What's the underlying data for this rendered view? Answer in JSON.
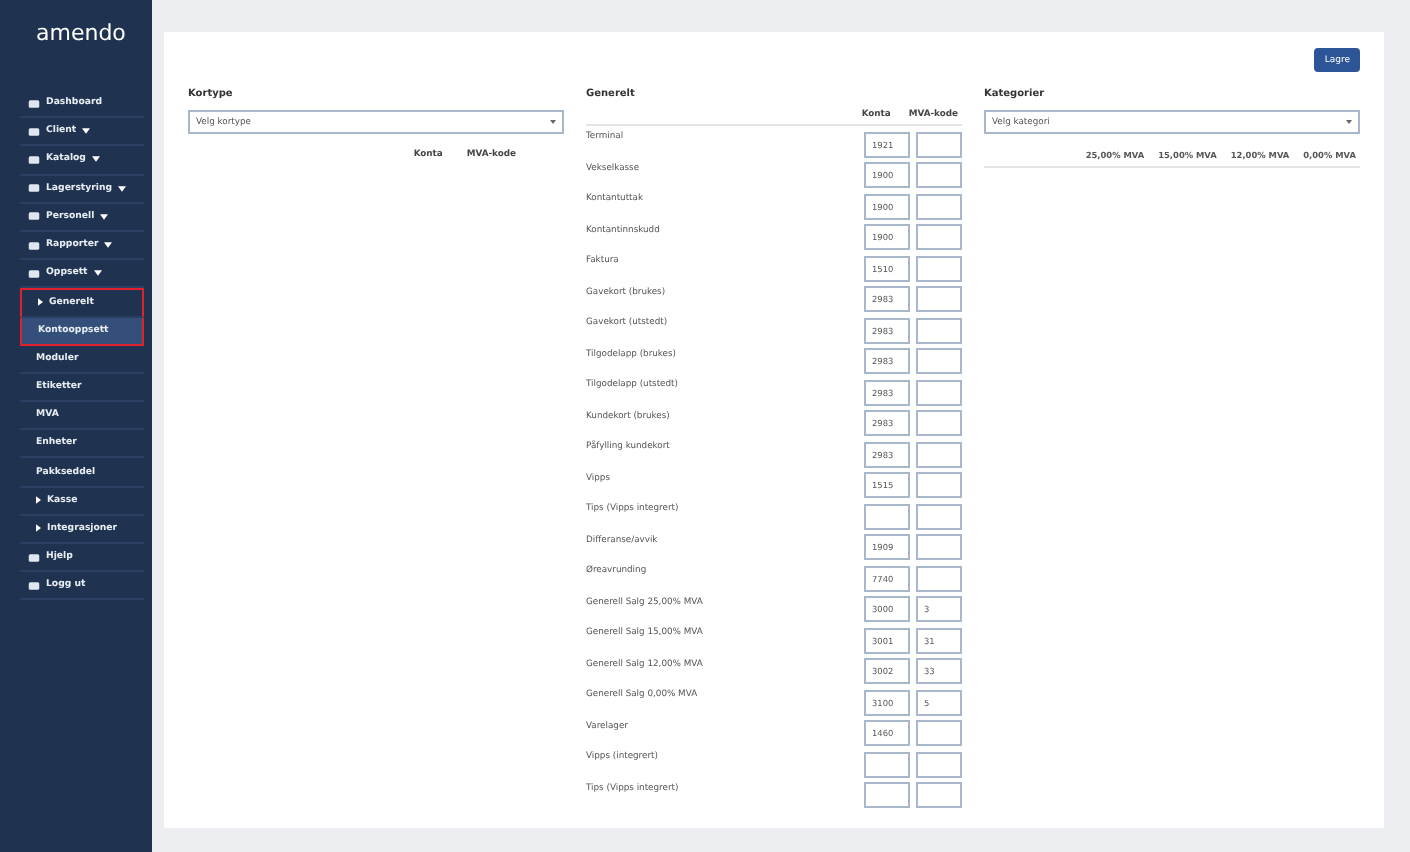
{
  "sidebar": {
    "logo": "amendo",
    "items": [
      {
        "label": "Dashboard",
        "kind": "main",
        "caret": false,
        "dropdown": false,
        "selected": false,
        "highlighted": false
      },
      {
        "label": "Client",
        "kind": "main",
        "caret": false,
        "dropdown": true,
        "selected": false,
        "highlighted": false
      },
      {
        "label": "Katalog",
        "kind": "main",
        "caret": false,
        "dropdown": true,
        "selected": false,
        "highlighted": false
      },
      {
        "label": "Lagerstyring",
        "kind": "main",
        "caret": false,
        "dropdown": true,
        "selected": false,
        "highlighted": false
      },
      {
        "label": "Personell",
        "kind": "main",
        "caret": false,
        "dropdown": true,
        "selected": false,
        "highlighted": false
      },
      {
        "label": "Rapporter",
        "kind": "main",
        "caret": false,
        "dropdown": true,
        "selected": false,
        "highlighted": false
      },
      {
        "label": "Oppsett",
        "kind": "main",
        "caret": false,
        "dropdown": true,
        "selected": false,
        "highlighted": false
      },
      {
        "label": "Generelt",
        "kind": "sub",
        "caret": true,
        "dropdown": false,
        "selected": false,
        "highlighted": true
      },
      {
        "label": "Kontooppsett",
        "kind": "sub",
        "caret": false,
        "dropdown": false,
        "selected": true,
        "highlighted": true
      },
      {
        "label": "Moduler",
        "kind": "sub",
        "caret": false,
        "dropdown": false,
        "selected": false,
        "highlighted": false
      },
      {
        "label": "Etiketter",
        "kind": "sub",
        "caret": false,
        "dropdown": false,
        "selected": false,
        "highlighted": false
      },
      {
        "label": "MVA",
        "kind": "sub",
        "caret": false,
        "dropdown": false,
        "selected": false,
        "highlighted": false
      },
      {
        "label": "Enheter",
        "kind": "sub",
        "caret": false,
        "dropdown": false,
        "selected": false,
        "highlighted": false
      },
      {
        "label": "Pakkseddel",
        "kind": "sub",
        "caret": false,
        "dropdown": false,
        "selected": false,
        "highlighted": false
      },
      {
        "label": "Kasse",
        "kind": "sub",
        "caret": true,
        "dropdown": false,
        "selected": false,
        "highlighted": false
      },
      {
        "label": "Integrasjoner",
        "kind": "sub",
        "caret": true,
        "dropdown": false,
        "selected": false,
        "highlighted": false
      },
      {
        "label": "Hjelp",
        "kind": "main",
        "caret": false,
        "dropdown": false,
        "selected": false,
        "highlighted": false
      },
      {
        "label": "Logg ut",
        "kind": "main",
        "caret": false,
        "dropdown": false,
        "selected": false,
        "highlighted": false
      }
    ]
  },
  "save_button": "Lagre",
  "kortype": {
    "title": "Kortype",
    "select": "Velg kortype",
    "columns": [
      "Konta",
      "MVA-kode"
    ]
  },
  "generelt": {
    "title": "Generelt",
    "columns": [
      "Konta",
      "MVA-kode"
    ],
    "rows": [
      {
        "label": "Terminal",
        "konta": "1921",
        "mva": ""
      },
      {
        "label": "Vekselkasse",
        "konta": "1900",
        "mva": ""
      },
      {
        "label": "Kontantuttak",
        "konta": "1900",
        "mva": ""
      },
      {
        "label": "Kontantinnskudd",
        "konta": "1900",
        "mva": ""
      },
      {
        "label": "Faktura",
        "konta": "1510",
        "mva": ""
      },
      {
        "label": "Gavekort (brukes)",
        "konta": "2983",
        "mva": ""
      },
      {
        "label": "Gavekort (utstedt)",
        "konta": "2983",
        "mva": ""
      },
      {
        "label": "Tilgodelapp (brukes)",
        "konta": "2983",
        "mva": ""
      },
      {
        "label": "Tilgodelapp (utstedt)",
        "konta": "2983",
        "mva": ""
      },
      {
        "label": "Kundekort (brukes)",
        "konta": "2983",
        "mva": ""
      },
      {
        "label": "Påfylling kundekort",
        "konta": "2983",
        "mva": ""
      },
      {
        "label": "Vipps",
        "konta": "1515",
        "mva": ""
      },
      {
        "label": "Tips (Vipps integrert)",
        "konta": "",
        "mva": ""
      },
      {
        "label": "Differanse/avvik",
        "konta": "1909",
        "mva": ""
      },
      {
        "label": "Øreavrunding",
        "konta": "7740",
        "mva": ""
      },
      {
        "label": "Generell Salg 25,00% MVA",
        "konta": "3000",
        "mva": "3"
      },
      {
        "label": "Generell Salg 15,00% MVA",
        "konta": "3001",
        "mva": "31"
      },
      {
        "label": "Generell Salg 12,00% MVA",
        "konta": "3002",
        "mva": "33"
      },
      {
        "label": "Generell Salg 0,00% MVA",
        "konta": "3100",
        "mva": "5"
      },
      {
        "label": "Varelager",
        "konta": "1460",
        "mva": ""
      },
      {
        "label": "Vipps (integrert)",
        "konta": "",
        "mva": ""
      },
      {
        "label": "Tips (Vipps integrert)",
        "konta": "",
        "mva": ""
      }
    ]
  },
  "kategorier": {
    "title": "Kategorier",
    "select": "Velg kategori",
    "columns": [
      "25,00% MVA",
      "15,00% MVA",
      "12,00% MVA",
      "0,00% MVA"
    ]
  }
}
